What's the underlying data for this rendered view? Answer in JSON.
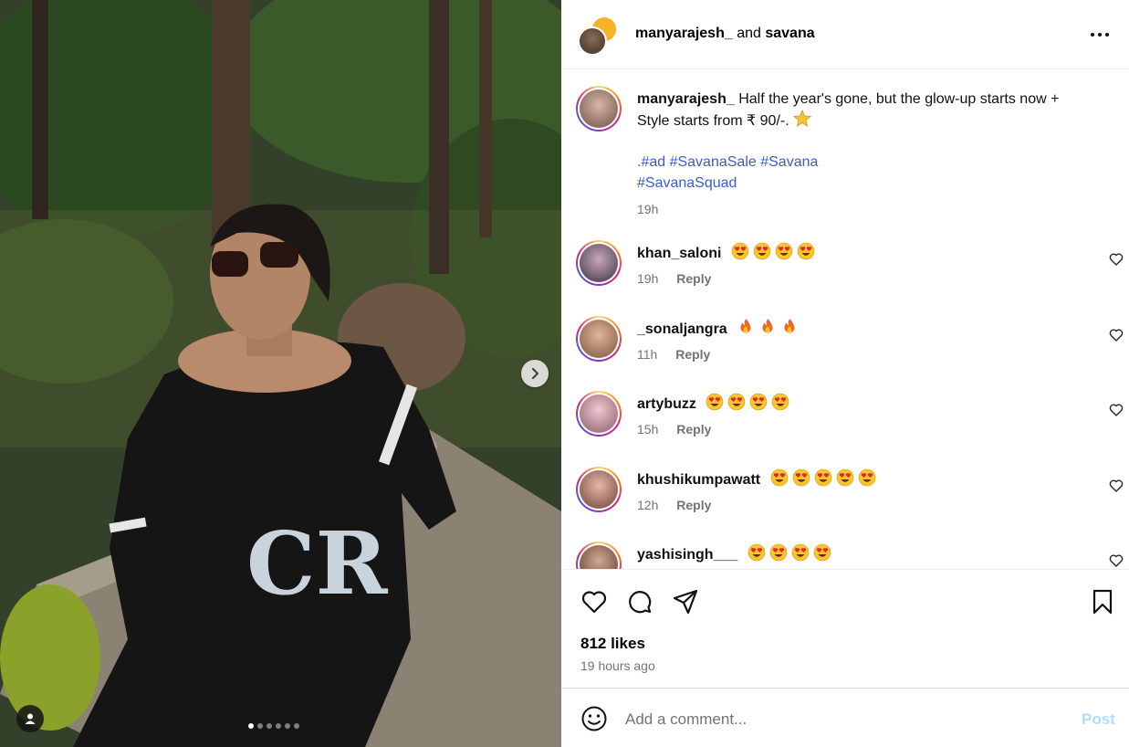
{
  "post": {
    "header": {
      "author": "manyarajesh_",
      "connector": "and",
      "collaborator": "savana",
      "more_icon": "more-horizontal-icon"
    },
    "caption": {
      "username": "manyarajesh_",
      "text": "Half the year's gone, but the glow-up starts now + Style starts from ₹ 90/-.",
      "emoji": "star",
      "hashtags_line1": ".#ad #SavanaSale #Savana",
      "hashtags_line2": "#SavanaSquad",
      "time": "19h"
    },
    "comments": [
      {
        "username": "khan_saloni",
        "emoji": "heart-eyes",
        "emoji_count": 4,
        "time": "19h",
        "reply": "Reply"
      },
      {
        "username": "_sonaljangra",
        "emoji": "fire",
        "emoji_count": 3,
        "time": "11h",
        "reply": "Reply"
      },
      {
        "username": "artybuzz",
        "emoji": "heart-eyes",
        "emoji_count": 4,
        "time": "15h",
        "reply": "Reply"
      },
      {
        "username": "khushikumpawatt",
        "emoji": "heart-eyes",
        "emoji_count": 5,
        "time": "12h",
        "reply": "Reply"
      },
      {
        "username": "yashisingh___",
        "emoji": "heart-eyes",
        "emoji_count": 4,
        "time": "",
        "reply": ""
      }
    ],
    "likes": "812 likes",
    "posted_ago": "19 hours ago",
    "add_comment": {
      "placeholder": "Add a comment...",
      "post_label": "Post"
    },
    "carousel": {
      "slides": 6,
      "current": 1
    },
    "colors": {
      "link": "#3a5dcb",
      "muted": "#737373",
      "post_disabled": "#b3dbff"
    }
  }
}
